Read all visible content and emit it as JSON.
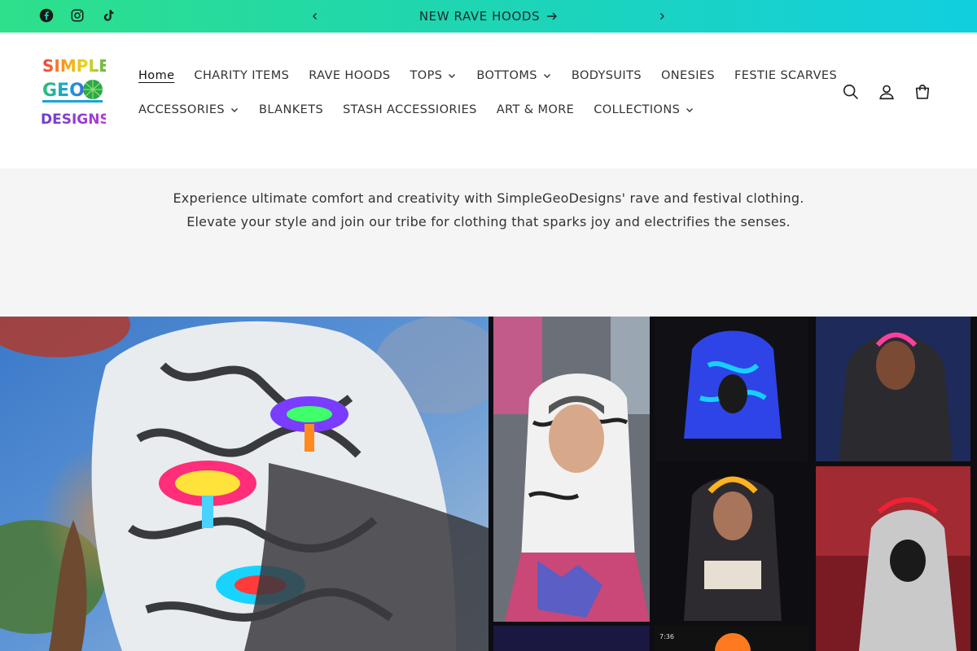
{
  "announcement": {
    "message": "NEW RAVE HOODS",
    "social_icons": [
      "facebook-icon",
      "instagram-icon",
      "tiktok-icon"
    ],
    "gradient": [
      "#2ee08a",
      "#12cfe0"
    ]
  },
  "brand": {
    "logo_lines": [
      "SIMPLE",
      "GEO",
      "DESIGNS"
    ]
  },
  "nav": {
    "row1": [
      {
        "label": "Home",
        "dropdown": false,
        "active": true
      },
      {
        "label": "CHARITY ITEMS",
        "dropdown": false
      },
      {
        "label": "RAVE HOODS",
        "dropdown": false
      },
      {
        "label": "TOPS",
        "dropdown": true
      },
      {
        "label": "BOTTOMS",
        "dropdown": true
      },
      {
        "label": "BODYSUITS",
        "dropdown": false
      },
      {
        "label": "ONESIES",
        "dropdown": false
      },
      {
        "label": "FESTIE SCARVES",
        "dropdown": false
      }
    ],
    "row2": [
      {
        "label": "ACCESSORIES",
        "dropdown": true
      },
      {
        "label": "BLANKETS",
        "dropdown": false
      },
      {
        "label": "STASH ACCESSIORIES",
        "dropdown": false
      },
      {
        "label": "ART & MORE",
        "dropdown": false
      },
      {
        "label": "COLLECTIONS",
        "dropdown": true
      }
    ]
  },
  "header_icons": [
    "search-icon",
    "account-icon",
    "cart-icon"
  ],
  "intro": {
    "text": "Experience ultimate comfort and creativity with SimpleGeoDesigns' rave and festival clothing. Elevate your style and join our tribe for clothing that sparks joy and electrifies the senses."
  },
  "hero": {
    "left_image": "hooded-person-psychedelic-print",
    "right_image": "photo-collage-rave-hoods",
    "collage_timestamp": "7:36"
  }
}
